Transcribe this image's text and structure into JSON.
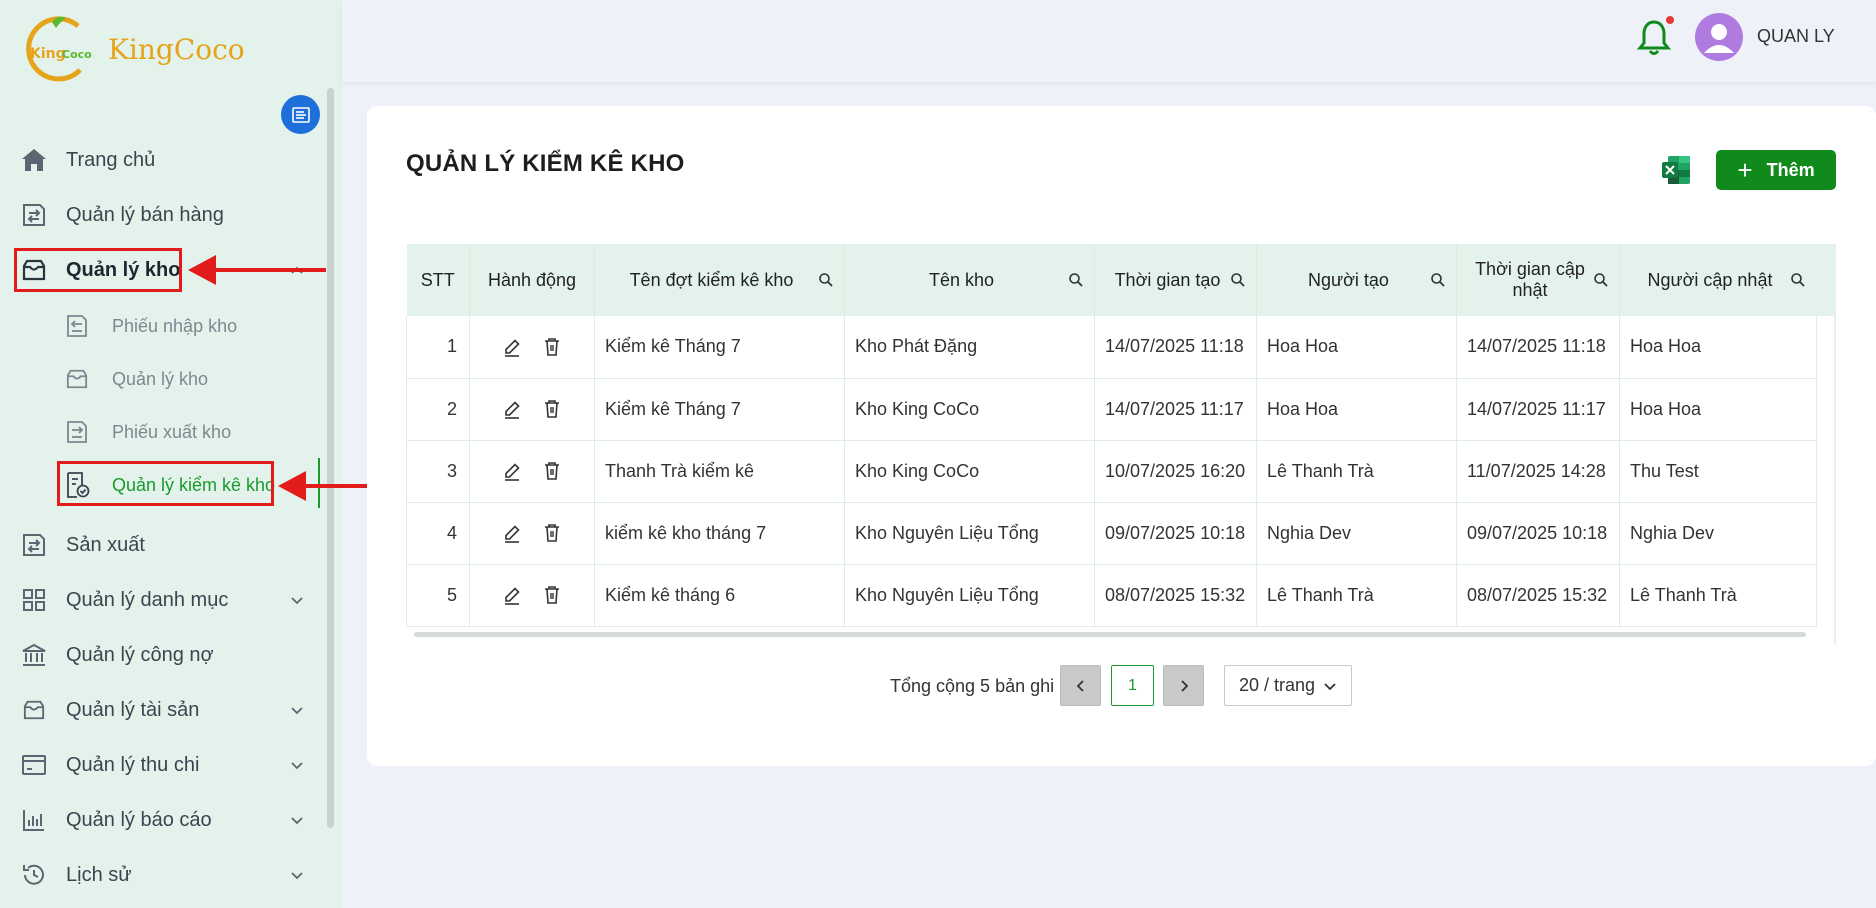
{
  "brand": {
    "name": "KingCoco",
    "logo_text": "KingCoco"
  },
  "header": {
    "username": "QUAN LY"
  },
  "sidebar": {
    "items": [
      {
        "label": "Trang chủ",
        "icon": "home-icon"
      },
      {
        "label": "Quản lý bán hàng",
        "icon": "sales-icon"
      },
      {
        "label": "Quản lý kho",
        "icon": "warehouse-icon",
        "expanded": true
      },
      {
        "label": "Sản xuất",
        "icon": "production-icon"
      },
      {
        "label": "Quản lý danh mục",
        "icon": "grid-icon"
      },
      {
        "label": "Quản lý công nợ",
        "icon": "bank-icon"
      },
      {
        "label": "Quản lý tài sản",
        "icon": "box-icon"
      },
      {
        "label": "Quản lý thu chi",
        "icon": "card-icon"
      },
      {
        "label": "Quản lý báo cáo",
        "icon": "chart-icon"
      },
      {
        "label": "Lịch sử",
        "icon": "history-icon"
      }
    ],
    "sub_items": [
      {
        "label": "Phiếu nhập kho",
        "icon": "import-icon"
      },
      {
        "label": "Quản lý kho",
        "icon": "warehouse-icon"
      },
      {
        "label": "Phiếu xuất kho",
        "icon": "export-icon"
      },
      {
        "label": "Quản lý kiểm kê kho",
        "icon": "inventory-check-icon",
        "active": true
      }
    ]
  },
  "page": {
    "title": "QUẢN LÝ KIỂM KÊ KHO",
    "add_label": "Thêm"
  },
  "table": {
    "columns": [
      "STT",
      "Hành động",
      "Tên đợt kiểm kê kho",
      "Tên kho",
      "Thời gian tạo",
      "Người tạo",
      "Thời gian cập nhật",
      "Người cập nhật"
    ],
    "rows": [
      {
        "stt": "1",
        "name": "Kiểm kê Tháng 7",
        "warehouse": "Kho Phát Đặng",
        "created": "14/07/2025 11:18",
        "creator": "Hoa Hoa",
        "updated": "14/07/2025 11:18",
        "updater": "Hoa Hoa"
      },
      {
        "stt": "2",
        "name": "Kiểm kê Tháng 7",
        "warehouse": "Kho King CoCo",
        "created": "14/07/2025 11:17",
        "creator": "Hoa Hoa",
        "updated": "14/07/2025 11:17",
        "updater": "Hoa Hoa"
      },
      {
        "stt": "3",
        "name": "Thanh Trà kiểm kê",
        "warehouse": "Kho King CoCo",
        "created": "10/07/2025 16:20",
        "creator": "Lê Thanh Trà",
        "updated": "11/07/2025 14:28",
        "updater": "Thu Test"
      },
      {
        "stt": "4",
        "name": "kiểm kê kho tháng 7",
        "warehouse": "Kho Nguyên Liệu Tổng",
        "created": "09/07/2025 10:18",
        "creator": "Nghia Dev",
        "updated": "09/07/2025 10:18",
        "updater": "Nghia Dev"
      },
      {
        "stt": "5",
        "name": "Kiểm kê tháng 6",
        "warehouse": "Kho Nguyên Liệu Tổng",
        "created": "08/07/2025 15:32",
        "creator": "Lê Thanh Trà",
        "updated": "08/07/2025 15:32",
        "updater": "Lê Thanh Trà"
      }
    ]
  },
  "pagination": {
    "total_text": "Tổng cộng 5 bản ghi",
    "current_page": "1",
    "page_size": "20 / trang"
  },
  "colors": {
    "accent": "#0f8a1b",
    "sidebar_bg": "#e3f3eb",
    "highlight": "#e21b1b",
    "active_text": "#1a9a2c"
  }
}
